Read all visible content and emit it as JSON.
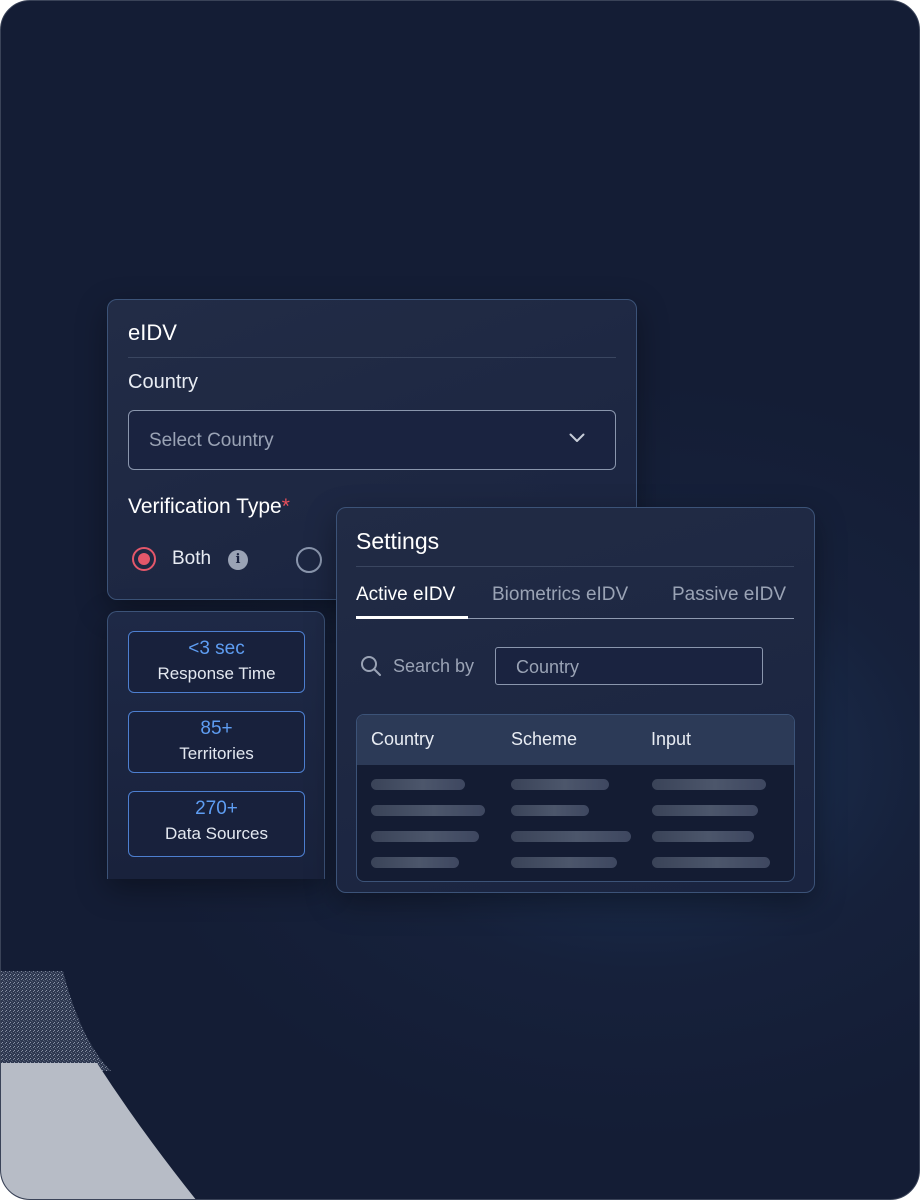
{
  "eidv_panel": {
    "title": "eIDV",
    "country_label": "Country",
    "country_select": {
      "placeholder": "Select Country"
    },
    "verification_type_label": "Verification Type",
    "required_marker": "*",
    "options": [
      {
        "label": "Both",
        "selected": true,
        "has_info_icon": true
      },
      {
        "label": "",
        "selected": false
      }
    ]
  },
  "stats": [
    {
      "value": "<3 sec",
      "label": "Response Time"
    },
    {
      "value": "85+",
      "label": "Territories"
    },
    {
      "value": "270+",
      "label": "Data Sources"
    }
  ],
  "settings_panel": {
    "title": "Settings",
    "tabs": [
      {
        "label": "Active eIDV",
        "active": true
      },
      {
        "label": "Biometrics eIDV",
        "active": false
      },
      {
        "label": "Passive eIDV",
        "active": false
      }
    ],
    "search": {
      "label": "Search by",
      "field_value": "Country"
    },
    "table": {
      "columns": [
        "Country",
        "Scheme",
        "Input"
      ],
      "rows_loading": 4
    }
  },
  "icons": {
    "select_chevron": "chevron-down-icon",
    "info": "info-icon",
    "search": "search-icon"
  },
  "colors": {
    "background": "#16213b",
    "accent_blue": "#5e9df2",
    "radio_selected": "#e4576a",
    "required": "#e8505b",
    "stat_border": "#4d7fd0"
  }
}
